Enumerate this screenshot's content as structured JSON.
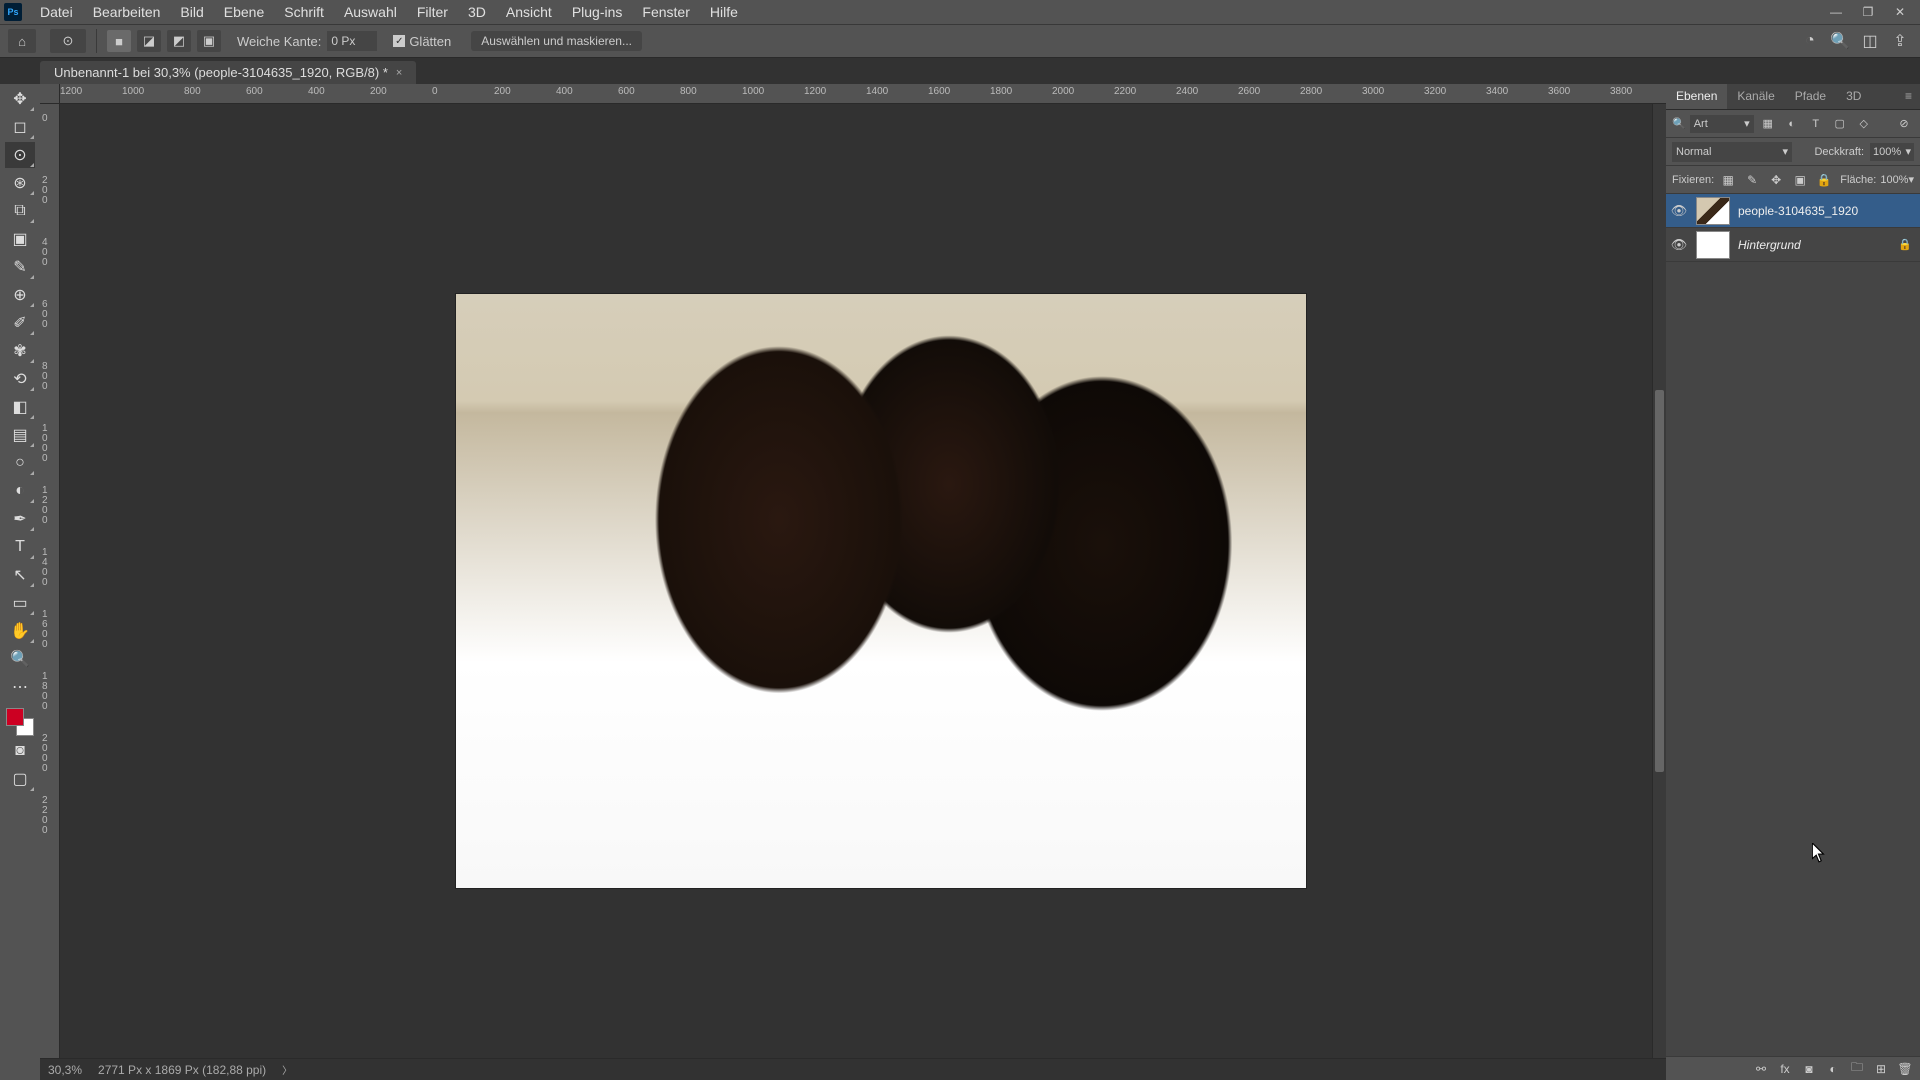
{
  "app": {
    "logo_text": "Ps"
  },
  "menu": {
    "items": [
      "Datei",
      "Bearbeiten",
      "Bild",
      "Ebene",
      "Schrift",
      "Auswahl",
      "Filter",
      "3D",
      "Ansicht",
      "Plug-ins",
      "Fenster",
      "Hilfe"
    ]
  },
  "window_controls": {
    "min": "—",
    "max": "❐",
    "close": "✕"
  },
  "options": {
    "weiche_kante_label": "Weiche Kante:",
    "weiche_kante_value": "0 Px",
    "glaetten_label": "Glätten",
    "select_mask_label": "Auswählen und maskieren..."
  },
  "doc_tab": {
    "title": "Unbenannt-1 bei 30,3% (people-3104635_1920, RGB/8) *",
    "close": "×"
  },
  "ruler_h": [
    "1200",
    "1000",
    "800",
    "600",
    "400",
    "200",
    "0",
    "200",
    "400",
    "600",
    "800",
    "1000",
    "1200",
    "1400",
    "1600",
    "1800",
    "2000",
    "2200",
    "2400",
    "2600",
    "2800",
    "3000",
    "3200",
    "3400",
    "3600",
    "3800"
  ],
  "ruler_v": [
    "0",
    "200",
    "400",
    "600",
    "800",
    "1000",
    "1200",
    "1400",
    "1600",
    "1800",
    "2000",
    "2200"
  ],
  "status": {
    "zoom": "30,3%",
    "doc_info": "2771 Px x 1869 Px (182,88 ppi)",
    "chev": "〉"
  },
  "panels": {
    "tabs": [
      "Ebenen",
      "Kanäle",
      "Pfade",
      "3D"
    ],
    "kind_label": "Art",
    "blend_mode": "Normal",
    "opacity_label": "Deckkraft:",
    "opacity_value": "100%",
    "lock_label": "Fixieren:",
    "fill_label": "Fläche:",
    "fill_value": "100%"
  },
  "layers": [
    {
      "name": "people-3104635_1920",
      "italic": false,
      "locked": false,
      "selected": true,
      "thumb": "img"
    },
    {
      "name": "Hintergrund",
      "italic": true,
      "locked": true,
      "selected": false,
      "thumb": "white"
    }
  ],
  "colors": {
    "foreground": "#cc0022",
    "background": "#ffffff"
  },
  "photo_hint": ""
}
